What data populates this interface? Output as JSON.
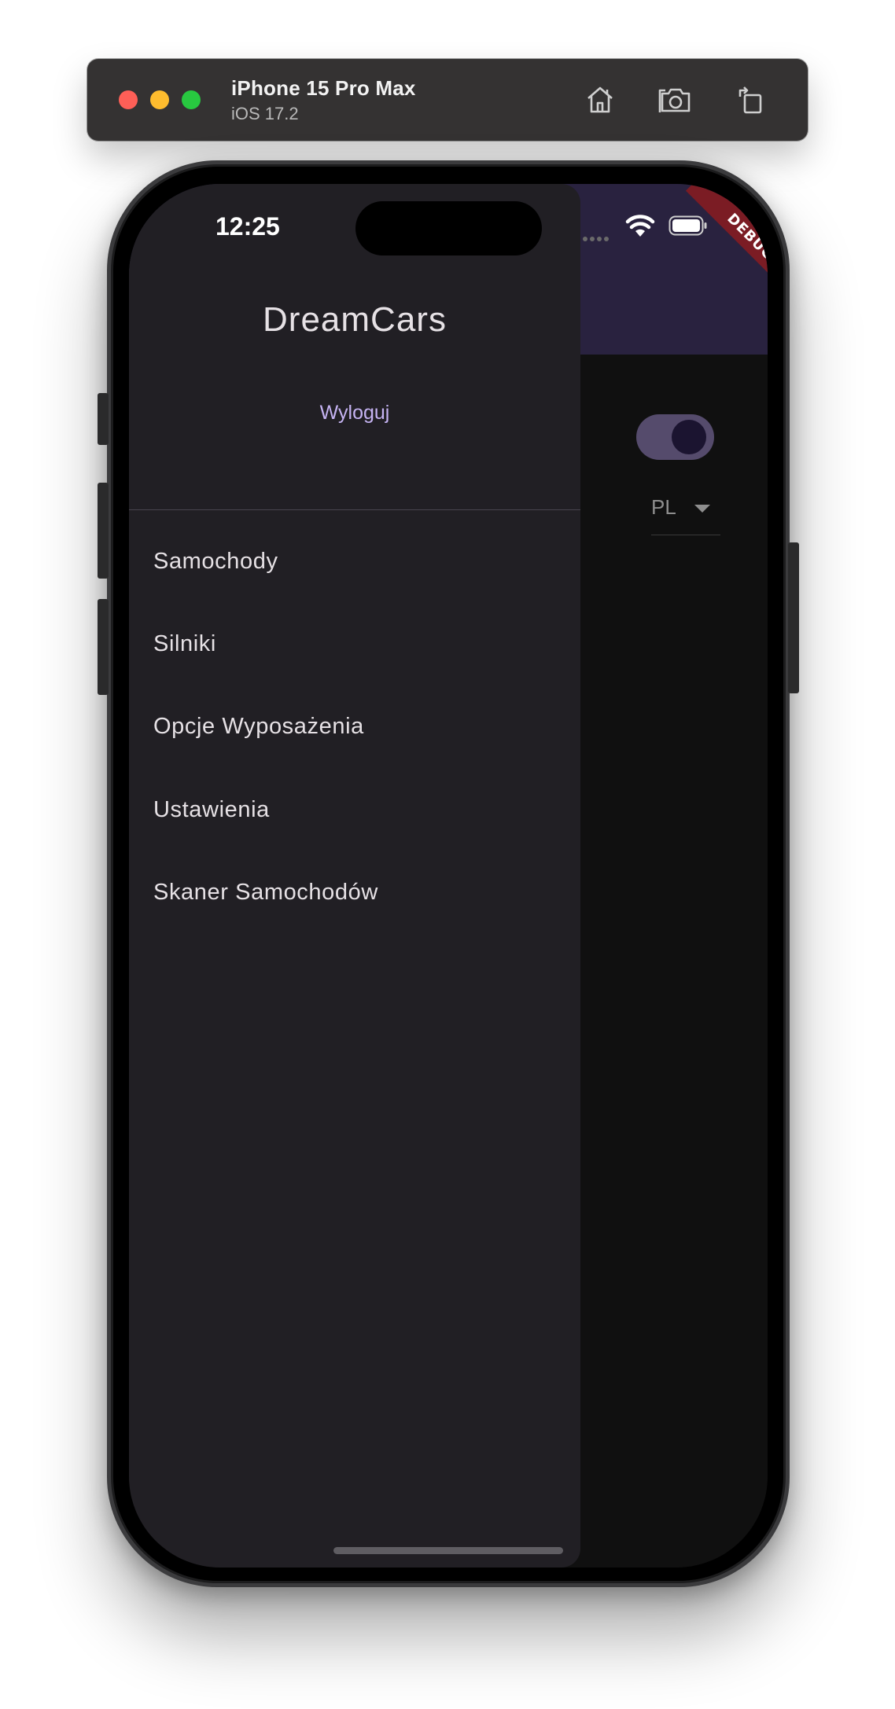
{
  "simulator": {
    "device_name": "iPhone 15 Pro Max",
    "os_version": "iOS 17.2",
    "toolbar_icons": [
      "home-icon",
      "screenshot-icon",
      "rotate-icon"
    ]
  },
  "status_bar": {
    "time": "12:25"
  },
  "debug_banner": "DEBUG",
  "settings_page": {
    "dark_mode_toggle": true,
    "language": "PL"
  },
  "drawer": {
    "title": "DreamCars",
    "logout_label": "Wyloguj",
    "items": [
      {
        "label": "Samochody"
      },
      {
        "label": "Silniki"
      },
      {
        "label": "Opcje Wyposażenia"
      },
      {
        "label": "Ustawienia"
      },
      {
        "label": "Skaner Samochodów"
      }
    ]
  },
  "colors": {
    "app_bar": "#29223f",
    "drawer_bg": "#211f24",
    "accent": "#c5b3f2",
    "debug_banner": "#7b1c24"
  }
}
